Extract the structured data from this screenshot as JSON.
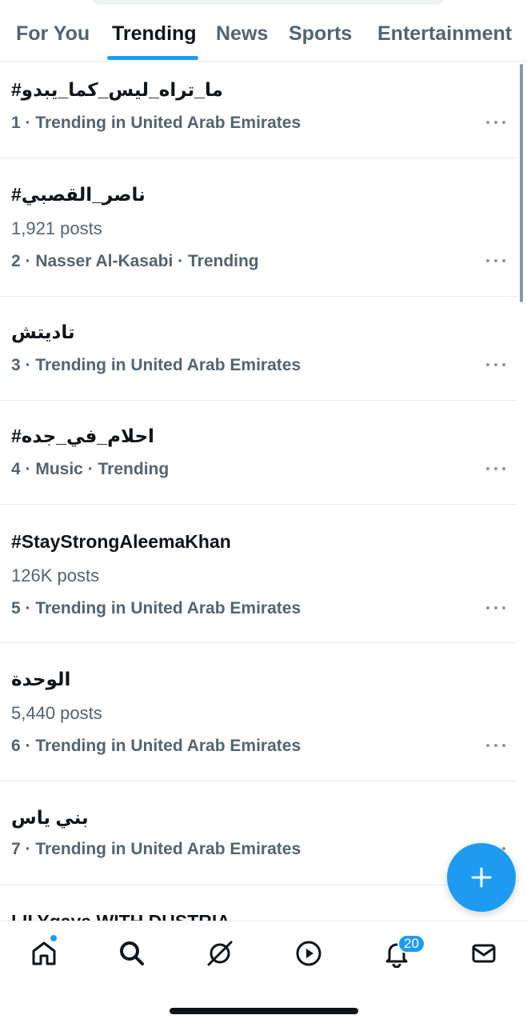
{
  "tabs": [
    {
      "label": "For You"
    },
    {
      "label": "Trending"
    },
    {
      "label": "News"
    },
    {
      "label": "Sports"
    },
    {
      "label": "Entertainment"
    }
  ],
  "active_tab": "Trending",
  "trends": [
    {
      "title": "#ما_تراه_ليس_كما_يبدو",
      "posts": "",
      "meta": "1 · Trending in United Arab Emirates"
    },
    {
      "title": "#ناصر_القصبي",
      "posts": "1,921 posts",
      "meta": "2 · Nasser Al-Kasabi · Trending"
    },
    {
      "title": "تاديتش",
      "posts": "",
      "meta": "3 · Trending in United Arab Emirates"
    },
    {
      "title": "#احلام_في_جده",
      "posts": "",
      "meta": "4 · Music · Trending"
    },
    {
      "title": "#StayStrongAleemaKhan",
      "posts": "126K posts",
      "meta": "5 · Trending in United Arab Emirates"
    },
    {
      "title": "الوحدة",
      "posts": "5,440 posts",
      "meta": "6 · Trending in United Arab Emirates"
    },
    {
      "title": "بني ياس",
      "posts": "",
      "meta": "7 · Trending in United Arab Emirates"
    }
  ],
  "partial_trend_title": "LILYgaya WITH DUSTRIA",
  "fab": {
    "icon": "plus-icon"
  },
  "bottom_nav": {
    "items": [
      "home-icon",
      "search-icon",
      "grok-icon",
      "video-icon",
      "notifications-icon",
      "messages-icon"
    ],
    "notification_count": "20"
  },
  "colors": {
    "accent": "#1d9bf0",
    "text": "#0f1419",
    "secondary": "#536471"
  }
}
